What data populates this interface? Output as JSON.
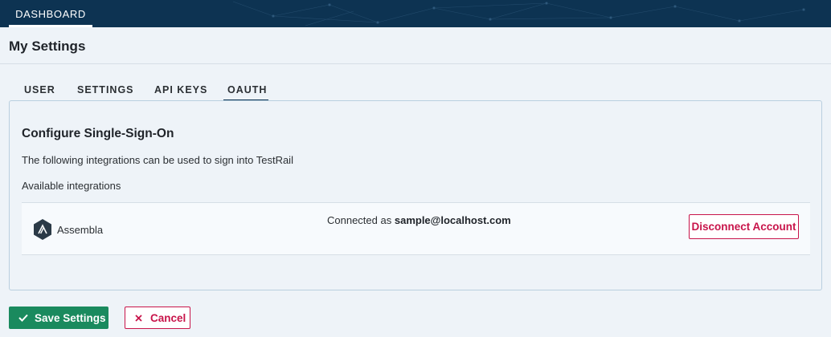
{
  "nav": {
    "dashboard_label": "DASHBOARD"
  },
  "page": {
    "title": "My Settings"
  },
  "tabs": [
    {
      "label": "USER"
    },
    {
      "label": "SETTINGS"
    },
    {
      "label": "API KEYS"
    },
    {
      "label": "OAUTH",
      "active": true
    }
  ],
  "oauth": {
    "title": "Configure Single-Sign-On",
    "description": "The following integrations can be used to sign into TestRail",
    "available_label": "Available integrations",
    "integrations": [
      {
        "name": "Assembla",
        "icon": "assembla-logo-icon",
        "connected_prefix": "Connected as",
        "connected_email": "sample@localhost.com",
        "disconnect_label": "Disconnect Account"
      }
    ]
  },
  "actions": {
    "save_label": "Save Settings",
    "cancel_label": "Cancel"
  },
  "colors": {
    "topbar": "#0d3352",
    "save": "#1a8a5e",
    "danger": "#c8144a",
    "background": "#eef3f8"
  }
}
